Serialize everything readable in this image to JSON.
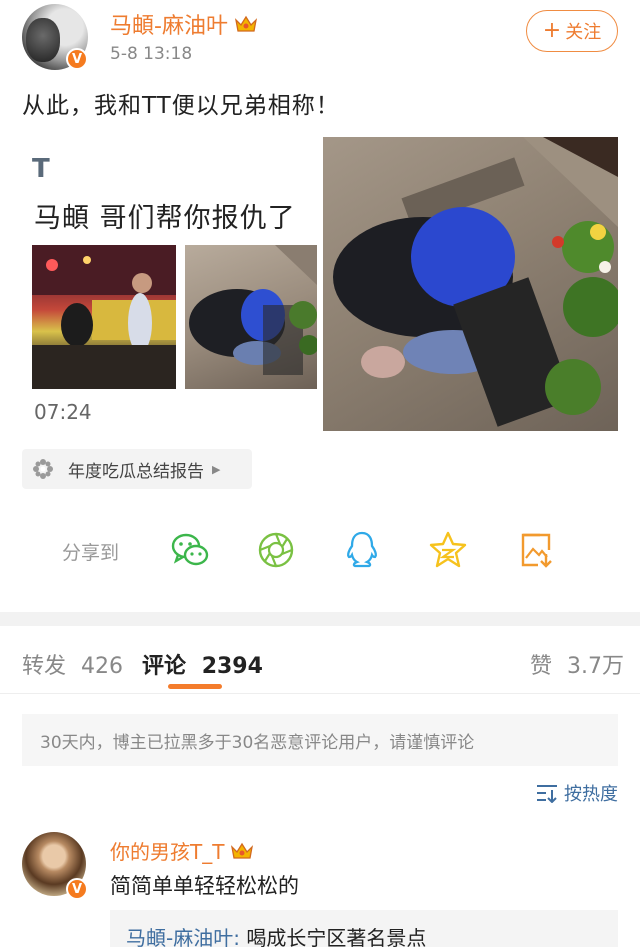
{
  "post": {
    "author": "马頔-麻油叶",
    "time": "5-8 13:18",
    "follow_label": "关注",
    "text": "从此，我和TT便以兄弟相称！",
    "card": {
      "badge": "T",
      "title": "马頔 哥们帮你报仇了",
      "duration": "07:24"
    },
    "report_chip": "年度吃瓜总结报告"
  },
  "share": {
    "label": "分享到",
    "targets": [
      "wechat-icon",
      "moments-icon",
      "qq-icon",
      "qzone-icon",
      "save-image-icon"
    ],
    "colors": {
      "wechat": "#3cb64b",
      "moments": "#7ac143",
      "qq": "#2fa9e8",
      "qzone": "#f6c21d",
      "save": "#f29a2e"
    }
  },
  "tabs": {
    "repost_label": "转发",
    "repost_count": "426",
    "comment_label": "评论",
    "comment_count": "2394",
    "like_label": "赞",
    "like_count": "3.7万"
  },
  "notice": "30天内，博主已拉黑多于30名恶意评论用户，请谨慎评论",
  "sort_label": "按热度",
  "comment": {
    "author": "你的男孩T_T",
    "text": "简简单单轻轻松松的",
    "reply_author": "马頔-麻油叶:",
    "reply_text": " 喝成长宁区著名景点"
  },
  "colors": {
    "accent": "#ee7c30",
    "link": "#3f6ea0",
    "vip": "#f57b1f"
  }
}
